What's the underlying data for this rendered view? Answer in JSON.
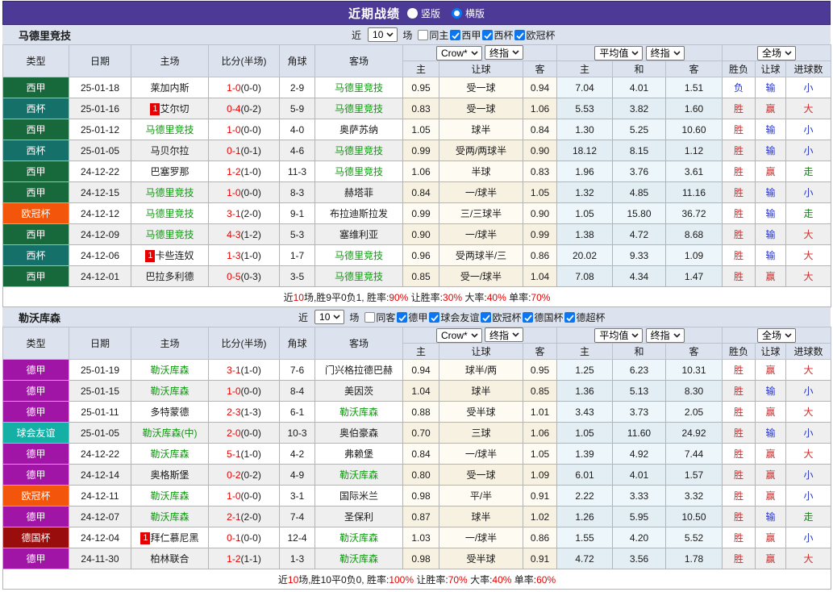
{
  "topbar": {
    "title": "近期战绩",
    "radios": [
      {
        "label": "竖版",
        "checked": false
      },
      {
        "label": "横版",
        "checked": true
      }
    ]
  },
  "table_header": {
    "type": "类型",
    "date": "日期",
    "home": "主场",
    "score": "比分(半场)",
    "corner": "角球",
    "away": "客场",
    "selects": {
      "bookmaker": "Crow*",
      "final1": "终指",
      "average": "平均值",
      "final2": "终指",
      "scope": "全场"
    },
    "sub": [
      "主",
      "让球",
      "客",
      "主",
      "和",
      "客",
      "胜负",
      "让球",
      "进球数"
    ]
  },
  "colors": {
    "bar": "#4c3a96",
    "bar_border": "#362a70",
    "head_bg": "#dde3ee",
    "grid": "#b4b4b4",
    "grid_head": "#b9c2cf",
    "check_blue": "#0b76ef",
    "red": "#d42a2a",
    "blue": "#2633cc",
    "team_green": "#0b9b0b",
    "walk_green": "#1e7d1e",
    "score_red": "#e60000",
    "cream_odd": "#fefbf2",
    "cream_even": "#f7f1e2",
    "blue_odd": "#edf6fa",
    "blue_even": "#e2edf4",
    "league": {
      "西甲": "#17693c",
      "西杯": "#16706a",
      "欧冠杯": "#f3560a",
      "德甲": "#a014a6",
      "球会友谊": "#14b0a6",
      "德国杯": "#990d0d"
    }
  },
  "sections": [
    {
      "team": "马德里竞技",
      "controls": {
        "recent_label": "近",
        "count": "10",
        "games_label": "场",
        "same_label": "同主",
        "same_checked": false,
        "leagues": [
          {
            "label": "西甲",
            "checked": true
          },
          {
            "label": "西杯",
            "checked": true
          },
          {
            "label": "欧冠杯",
            "checked": true
          }
        ]
      },
      "rows": [
        {
          "league": "西甲",
          "date": "25-01-18",
          "home": {
            "name": "莱加内斯"
          },
          "score": "1-0",
          "half": "(0-0)",
          "corner": "2-9",
          "away": {
            "name": "马德里竞技",
            "focal": true
          },
          "crow": [
            "0.95",
            "受一球",
            "0.94"
          ],
          "avg": [
            "7.04",
            "4.01",
            "1.51"
          ],
          "result": [
            {
              "t": "负",
              "c": "blue"
            },
            {
              "t": "输",
              "c": "blue"
            },
            {
              "t": "小",
              "c": "blue"
            }
          ]
        },
        {
          "league": "西杯",
          "date": "25-01-16",
          "home": {
            "name": "艾尔切",
            "badge": "1"
          },
          "score": "0-4",
          "half": "(0-2)",
          "corner": "5-9",
          "away": {
            "name": "马德里竞技",
            "focal": true
          },
          "crow": [
            "0.83",
            "受一球",
            "1.06"
          ],
          "avg": [
            "5.53",
            "3.82",
            "1.60"
          ],
          "result": [
            {
              "t": "胜",
              "c": "red"
            },
            {
              "t": "赢",
              "c": "red"
            },
            {
              "t": "大",
              "c": "red"
            }
          ]
        },
        {
          "league": "西甲",
          "date": "25-01-12",
          "home": {
            "name": "马德里竞技",
            "focal": true
          },
          "score": "1-0",
          "half": "(0-0)",
          "corner": "4-0",
          "away": {
            "name": "奥萨苏纳"
          },
          "crow": [
            "1.05",
            "球半",
            "0.84"
          ],
          "avg": [
            "1.30",
            "5.25",
            "10.60"
          ],
          "result": [
            {
              "t": "胜",
              "c": "red"
            },
            {
              "t": "输",
              "c": "blue"
            },
            {
              "t": "小",
              "c": "blue"
            }
          ]
        },
        {
          "league": "西杯",
          "date": "25-01-05",
          "home": {
            "name": "马贝尔拉"
          },
          "score": "0-1",
          "half": "(0-1)",
          "corner": "4-6",
          "away": {
            "name": "马德里竞技",
            "focal": true
          },
          "crow": [
            "0.99",
            "受两/两球半",
            "0.90"
          ],
          "avg": [
            "18.12",
            "8.15",
            "1.12"
          ],
          "result": [
            {
              "t": "胜",
              "c": "red"
            },
            {
              "t": "输",
              "c": "blue"
            },
            {
              "t": "小",
              "c": "blue"
            }
          ]
        },
        {
          "league": "西甲",
          "date": "24-12-22",
          "home": {
            "name": "巴塞罗那"
          },
          "score": "1-2",
          "half": "(1-0)",
          "corner": "11-3",
          "away": {
            "name": "马德里竞技",
            "focal": true
          },
          "crow": [
            "1.06",
            "半球",
            "0.83"
          ],
          "avg": [
            "1.96",
            "3.76",
            "3.61"
          ],
          "result": [
            {
              "t": "胜",
              "c": "red"
            },
            {
              "t": "赢",
              "c": "red"
            },
            {
              "t": "走",
              "c": "green"
            }
          ]
        },
        {
          "league": "西甲",
          "date": "24-12-15",
          "home": {
            "name": "马德里竞技",
            "focal": true
          },
          "score": "1-0",
          "half": "(0-0)",
          "corner": "8-3",
          "away": {
            "name": "赫塔菲"
          },
          "crow": [
            "0.84",
            "一/球半",
            "1.05"
          ],
          "avg": [
            "1.32",
            "4.85",
            "11.16"
          ],
          "result": [
            {
              "t": "胜",
              "c": "red"
            },
            {
              "t": "输",
              "c": "blue"
            },
            {
              "t": "小",
              "c": "blue"
            }
          ]
        },
        {
          "league": "欧冠杯",
          "date": "24-12-12",
          "home": {
            "name": "马德里竞技",
            "focal": true
          },
          "score": "3-1",
          "half": "(2-0)",
          "corner": "9-1",
          "away": {
            "name": "布拉迪斯拉发"
          },
          "crow": [
            "0.99",
            "三/三球半",
            "0.90"
          ],
          "avg": [
            "1.05",
            "15.80",
            "36.72"
          ],
          "result": [
            {
              "t": "胜",
              "c": "red"
            },
            {
              "t": "输",
              "c": "blue"
            },
            {
              "t": "走",
              "c": "green"
            }
          ]
        },
        {
          "league": "西甲",
          "date": "24-12-09",
          "home": {
            "name": "马德里竞技",
            "focal": true
          },
          "score": "4-3",
          "half": "(1-2)",
          "corner": "5-3",
          "away": {
            "name": "塞维利亚"
          },
          "crow": [
            "0.90",
            "一/球半",
            "0.99"
          ],
          "avg": [
            "1.38",
            "4.72",
            "8.68"
          ],
          "result": [
            {
              "t": "胜",
              "c": "red"
            },
            {
              "t": "输",
              "c": "blue"
            },
            {
              "t": "大",
              "c": "red"
            }
          ]
        },
        {
          "league": "西杯",
          "date": "24-12-06",
          "home": {
            "name": "卡些连奴",
            "badge": "1"
          },
          "score": "1-3",
          "half": "(1-0)",
          "corner": "1-7",
          "away": {
            "name": "马德里竞技",
            "focal": true
          },
          "crow": [
            "0.96",
            "受两球半/三",
            "0.86"
          ],
          "avg": [
            "20.02",
            "9.33",
            "1.09"
          ],
          "result": [
            {
              "t": "胜",
              "c": "red"
            },
            {
              "t": "输",
              "c": "blue"
            },
            {
              "t": "大",
              "c": "red"
            }
          ]
        },
        {
          "league": "西甲",
          "date": "24-12-01",
          "home": {
            "name": "巴拉多利德"
          },
          "score": "0-5",
          "half": "(0-3)",
          "corner": "3-5",
          "away": {
            "name": "马德里竞技",
            "focal": true
          },
          "crow": [
            "0.85",
            "受一/球半",
            "1.04"
          ],
          "avg": [
            "7.08",
            "4.34",
            "1.47"
          ],
          "result": [
            {
              "t": "胜",
              "c": "red"
            },
            {
              "t": "赢",
              "c": "red"
            },
            {
              "t": "大",
              "c": "red"
            }
          ]
        }
      ],
      "summary": {
        "seg1": "近",
        "n1": "10",
        "seg2": "场,胜9平0负1, 胜率:",
        "n2": "90%",
        "seg3": " 让胜率:",
        "n3": "30%",
        "seg4": " 大率:",
        "n4": "40%",
        "seg5": " 单率:",
        "n5": "70%"
      }
    },
    {
      "team": "勒沃库森",
      "controls": {
        "recent_label": "近",
        "count": "10",
        "games_label": "场",
        "same_label": "同客",
        "same_checked": false,
        "leagues": [
          {
            "label": "德甲",
            "checked": true
          },
          {
            "label": "球会友谊",
            "checked": true
          },
          {
            "label": "欧冠杯",
            "checked": true
          },
          {
            "label": "德国杯",
            "checked": true
          },
          {
            "label": "德超杯",
            "checked": true
          }
        ]
      },
      "rows": [
        {
          "league": "德甲",
          "date": "25-01-19",
          "home": {
            "name": "勒沃库森",
            "focal": true
          },
          "score": "3-1",
          "half": "(1-0)",
          "corner": "7-6",
          "away": {
            "name": "门兴格拉德巴赫"
          },
          "crow": [
            "0.94",
            "球半/两",
            "0.95"
          ],
          "avg": [
            "1.25",
            "6.23",
            "10.31"
          ],
          "result": [
            {
              "t": "胜",
              "c": "red"
            },
            {
              "t": "赢",
              "c": "red"
            },
            {
              "t": "大",
              "c": "red"
            }
          ]
        },
        {
          "league": "德甲",
          "date": "25-01-15",
          "home": {
            "name": "勒沃库森",
            "focal": true
          },
          "score": "1-0",
          "half": "(0-0)",
          "corner": "8-4",
          "away": {
            "name": "美因茨"
          },
          "crow": [
            "1.04",
            "球半",
            "0.85"
          ],
          "avg": [
            "1.36",
            "5.13",
            "8.30"
          ],
          "result": [
            {
              "t": "胜",
              "c": "red"
            },
            {
              "t": "输",
              "c": "blue"
            },
            {
              "t": "小",
              "c": "blue"
            }
          ]
        },
        {
          "league": "德甲",
          "date": "25-01-11",
          "home": {
            "name": "多特蒙德"
          },
          "score": "2-3",
          "half": "(1-3)",
          "corner": "6-1",
          "away": {
            "name": "勒沃库森",
            "focal": true
          },
          "crow": [
            "0.88",
            "受半球",
            "1.01"
          ],
          "avg": [
            "3.43",
            "3.73",
            "2.05"
          ],
          "result": [
            {
              "t": "胜",
              "c": "red"
            },
            {
              "t": "赢",
              "c": "red"
            },
            {
              "t": "大",
              "c": "red"
            }
          ]
        },
        {
          "league": "球会友谊",
          "date": "25-01-05",
          "home": {
            "name": "勒沃库森(中)",
            "focal": true
          },
          "score": "2-0",
          "half": "(0-0)",
          "corner": "10-3",
          "away": {
            "name": "奥伯豪森"
          },
          "crow": [
            "0.70",
            "三球",
            "1.06"
          ],
          "avg": [
            "1.05",
            "11.60",
            "24.92"
          ],
          "result": [
            {
              "t": "胜",
              "c": "red"
            },
            {
              "t": "输",
              "c": "blue"
            },
            {
              "t": "小",
              "c": "blue"
            }
          ]
        },
        {
          "league": "德甲",
          "date": "24-12-22",
          "home": {
            "name": "勒沃库森",
            "focal": true
          },
          "score": "5-1",
          "half": "(1-0)",
          "corner": "4-2",
          "away": {
            "name": "弗赖堡"
          },
          "crow": [
            "0.84",
            "一/球半",
            "1.05"
          ],
          "avg": [
            "1.39",
            "4.92",
            "7.44"
          ],
          "result": [
            {
              "t": "胜",
              "c": "red"
            },
            {
              "t": "赢",
              "c": "red"
            },
            {
              "t": "大",
              "c": "red"
            }
          ]
        },
        {
          "league": "德甲",
          "date": "24-12-14",
          "home": {
            "name": "奥格斯堡"
          },
          "score": "0-2",
          "half": "(0-2)",
          "corner": "4-9",
          "away": {
            "name": "勒沃库森",
            "focal": true
          },
          "crow": [
            "0.80",
            "受一球",
            "1.09"
          ],
          "avg": [
            "6.01",
            "4.01",
            "1.57"
          ],
          "result": [
            {
              "t": "胜",
              "c": "red"
            },
            {
              "t": "赢",
              "c": "red"
            },
            {
              "t": "小",
              "c": "blue"
            }
          ]
        },
        {
          "league": "欧冠杯",
          "date": "24-12-11",
          "home": {
            "name": "勒沃库森",
            "focal": true
          },
          "score": "1-0",
          "half": "(0-0)",
          "corner": "3-1",
          "away": {
            "name": "国际米兰"
          },
          "crow": [
            "0.98",
            "平/半",
            "0.91"
          ],
          "avg": [
            "2.22",
            "3.33",
            "3.32"
          ],
          "result": [
            {
              "t": "胜",
              "c": "red"
            },
            {
              "t": "赢",
              "c": "red"
            },
            {
              "t": "小",
              "c": "blue"
            }
          ]
        },
        {
          "league": "德甲",
          "date": "24-12-07",
          "home": {
            "name": "勒沃库森",
            "focal": true
          },
          "score": "2-1",
          "half": "(2-0)",
          "corner": "7-4",
          "away": {
            "name": "圣保利"
          },
          "crow": [
            "0.87",
            "球半",
            "1.02"
          ],
          "avg": [
            "1.26",
            "5.95",
            "10.50"
          ],
          "result": [
            {
              "t": "胜",
              "c": "red"
            },
            {
              "t": "输",
              "c": "blue"
            },
            {
              "t": "走",
              "c": "green"
            }
          ]
        },
        {
          "league": "德国杯",
          "date": "24-12-04",
          "home": {
            "name": "拜仁慕尼黑",
            "badge": "1"
          },
          "score": "0-1",
          "half": "(0-0)",
          "corner": "12-4",
          "away": {
            "name": "勒沃库森",
            "focal": true
          },
          "crow": [
            "1.03",
            "一/球半",
            "0.86"
          ],
          "avg": [
            "1.55",
            "4.20",
            "5.52"
          ],
          "result": [
            {
              "t": "胜",
              "c": "red"
            },
            {
              "t": "赢",
              "c": "red"
            },
            {
              "t": "小",
              "c": "blue"
            }
          ]
        },
        {
          "league": "德甲",
          "date": "24-11-30",
          "home": {
            "name": "柏林联合"
          },
          "score": "1-2",
          "half": "(1-1)",
          "corner": "1-3",
          "away": {
            "name": "勒沃库森",
            "focal": true
          },
          "crow": [
            "0.98",
            "受半球",
            "0.91"
          ],
          "avg": [
            "4.72",
            "3.56",
            "1.78"
          ],
          "result": [
            {
              "t": "胜",
              "c": "red"
            },
            {
              "t": "赢",
              "c": "red"
            },
            {
              "t": "大",
              "c": "red"
            }
          ]
        }
      ],
      "summary": {
        "seg1": "近",
        "n1": "10",
        "seg2": "场,胜10平0负0, 胜率:",
        "n2": "100%",
        "seg3": " 让胜率:",
        "n3": "70%",
        "seg4": " 大率:",
        "n4": "40%",
        "seg5": " 单率:",
        "n5": "60%"
      }
    }
  ]
}
